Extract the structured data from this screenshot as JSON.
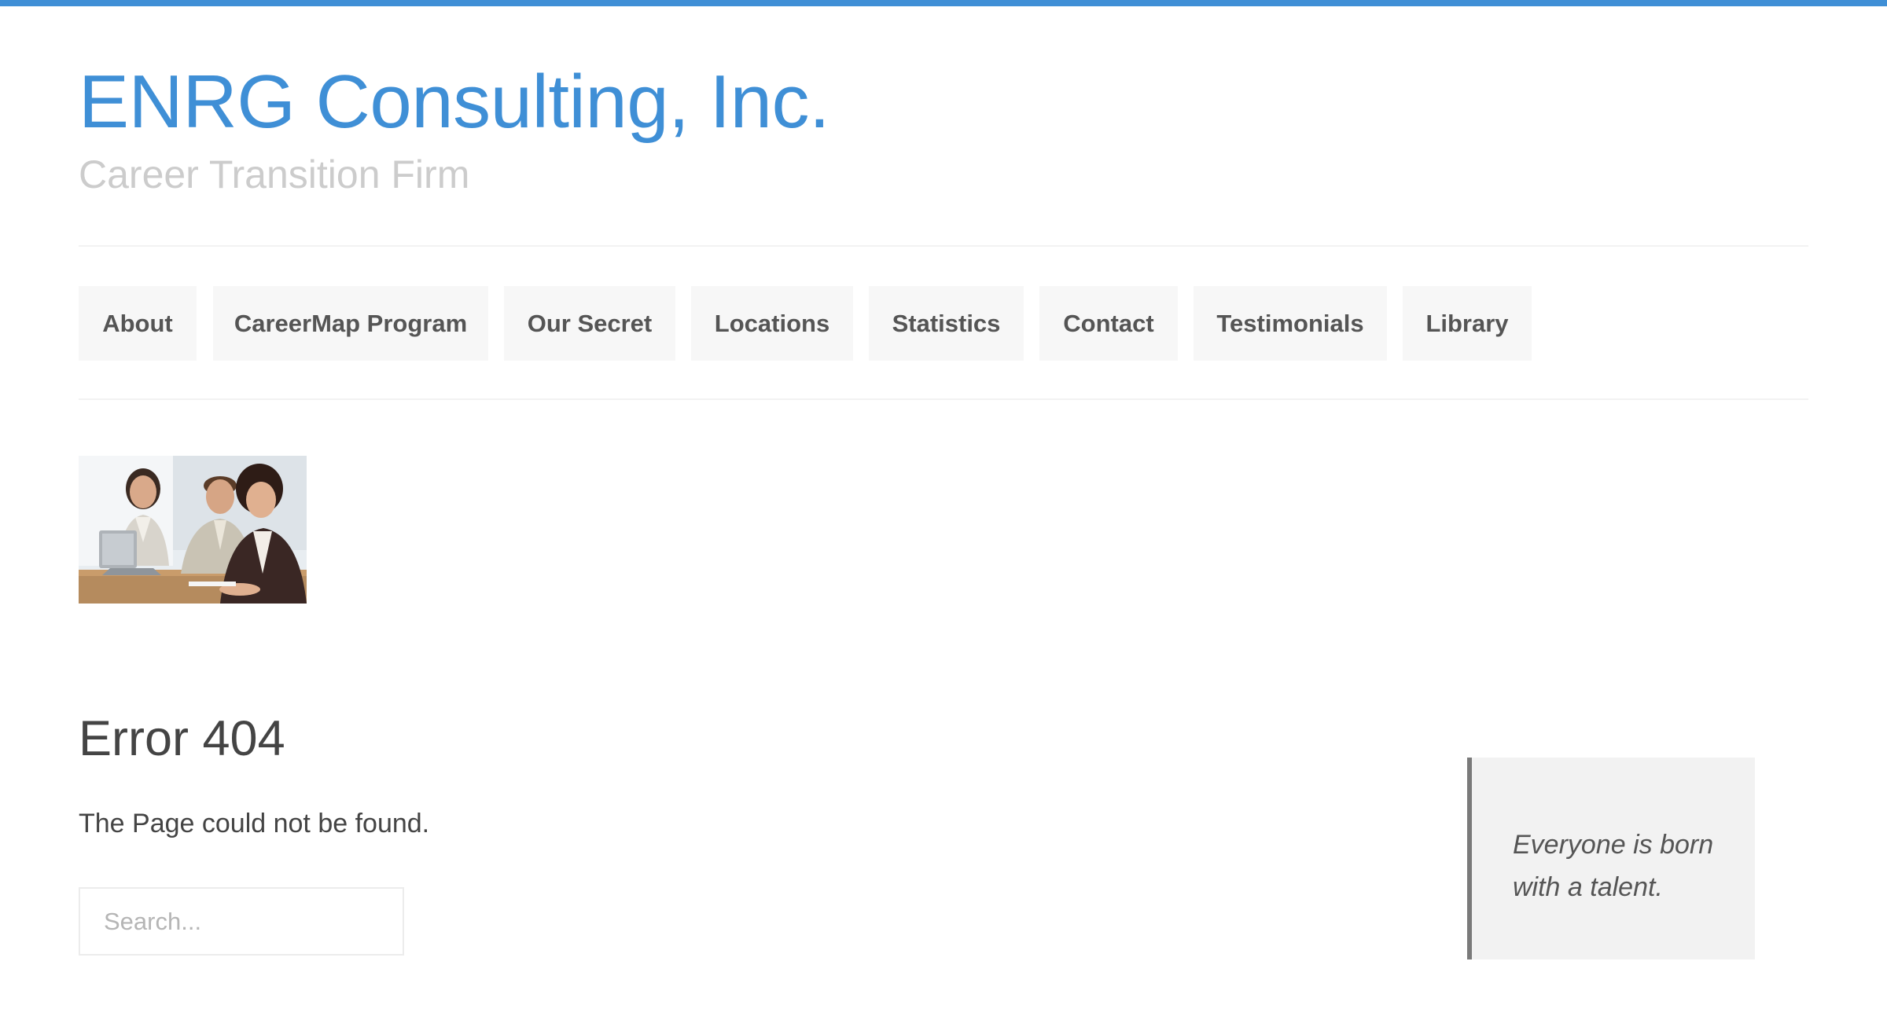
{
  "header": {
    "title": "ENRG Consulting, Inc.",
    "tagline": "Career Transition Firm"
  },
  "nav": {
    "items": [
      {
        "label": "About"
      },
      {
        "label": "CareerMap Program"
      },
      {
        "label": "Our Secret"
      },
      {
        "label": "Locations"
      },
      {
        "label": "Statistics"
      },
      {
        "label": "Contact"
      },
      {
        "label": "Testimonials"
      },
      {
        "label": "Library"
      }
    ]
  },
  "main": {
    "error_title": "Error 404",
    "error_message": "The Page could not be found.",
    "search": {
      "placeholder": "Search...",
      "value": ""
    }
  },
  "sidebar": {
    "quote": "Everyone is born with a talent."
  },
  "colors": {
    "accent": "#3f8fd6",
    "tagline": "#cccccc",
    "nav_bg": "#f7f7f7",
    "quote_bg": "#f2f2f2",
    "quote_border": "#7a7a7a"
  }
}
